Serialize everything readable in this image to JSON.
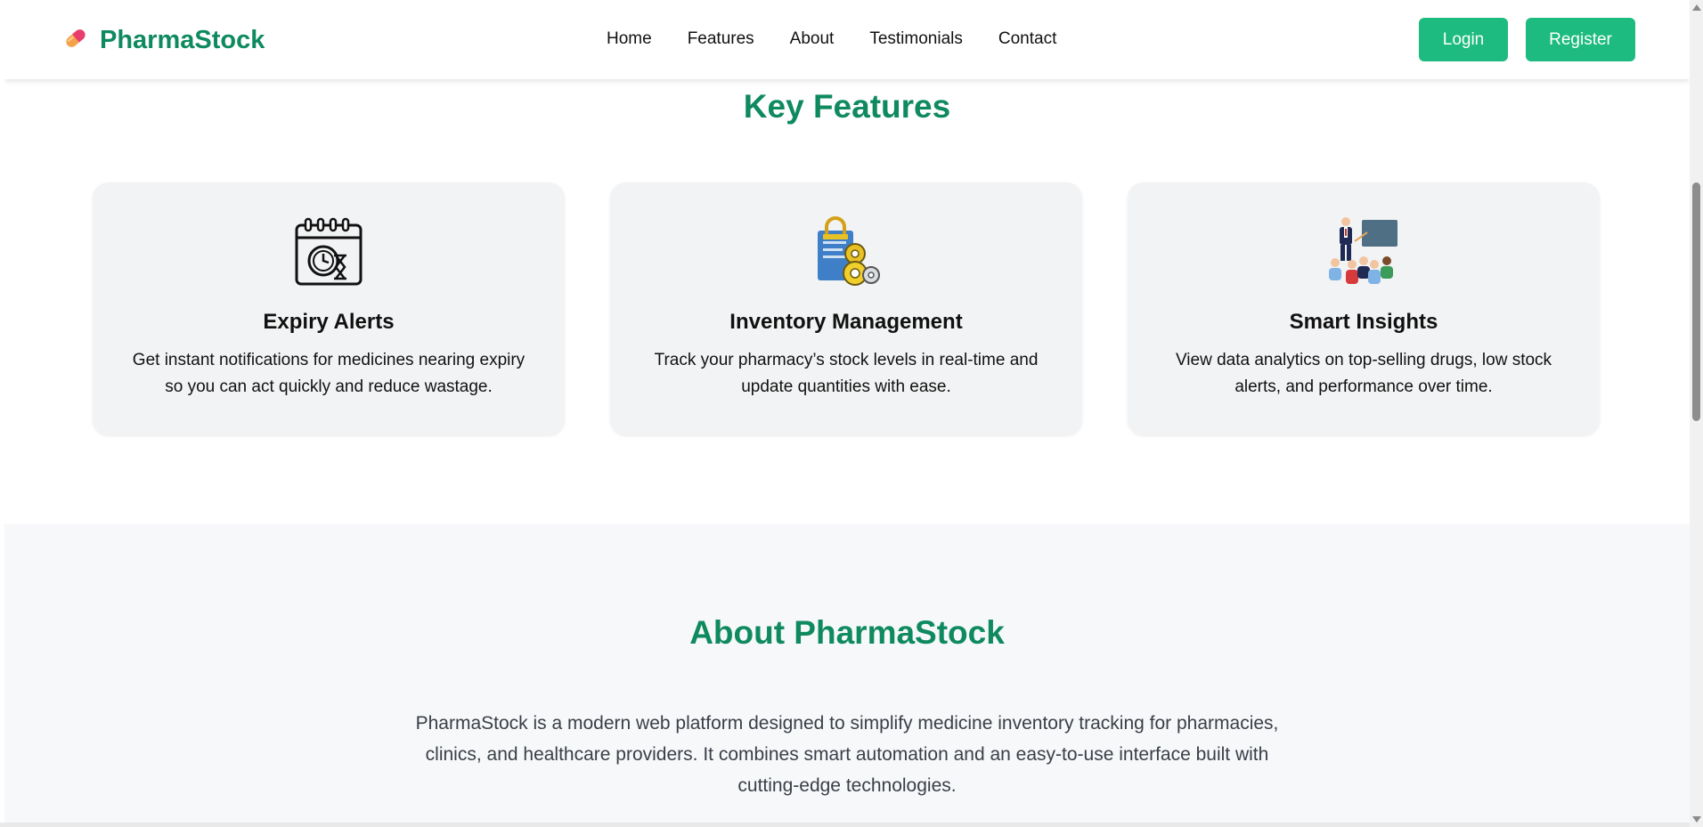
{
  "navbar": {
    "brand": "PharmaStock",
    "links": [
      "Home",
      "Features",
      "About",
      "Testimonials",
      "Contact"
    ],
    "login_label": "Login",
    "register_label": "Register"
  },
  "features": {
    "title": "Key Features",
    "cards": [
      {
        "icon": "calendar-clock-icon",
        "title": "Expiry Alerts",
        "description": "Get instant notifications for medicines nearing expiry so you can act quickly and reduce wastage."
      },
      {
        "icon": "inventory-lock-gear-icon",
        "title": "Inventory Management",
        "description": "Track your pharmacy’s stock levels in real-time and update quantities with ease."
      },
      {
        "icon": "presentation-audience-icon",
        "title": "Smart Insights",
        "description": "View data analytics on top-selling drugs, low stock alerts, and performance over time."
      }
    ]
  },
  "about": {
    "title": "About PharmaStock",
    "text": "PharmaStock is a modern web platform designed to simplify medicine inventory tracking for pharmacies, clinics, and healthcare providers. It combines smart automation and an easy-to-use interface built with cutting-edge technologies."
  },
  "colors": {
    "brand_green": "#0f8a5f",
    "button_green": "#1dbb7f",
    "card_bg": "#f2f3f4",
    "about_bg": "#f7f8fa"
  }
}
